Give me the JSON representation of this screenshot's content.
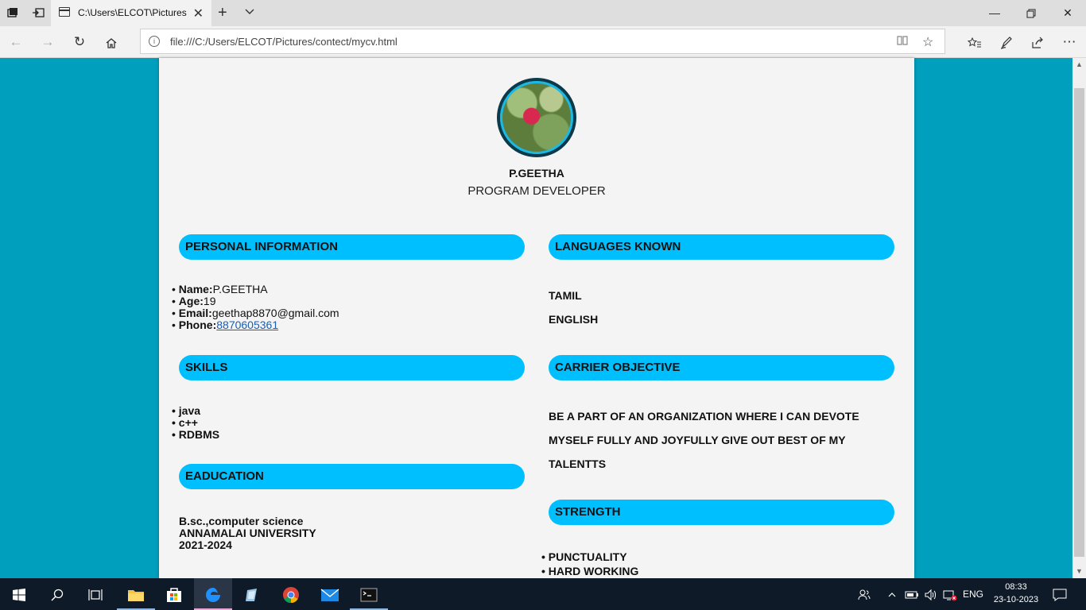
{
  "browser": {
    "tab_title": "C:\\Users\\ELCOT\\Pictures",
    "url": "file:///C:/Users/ELCOT/Pictures/contect/mycv.html"
  },
  "cv": {
    "name": "P.GEETHA",
    "role": "PROGRAM DEVELOPER",
    "personal": {
      "heading": "PERSONAL INFORMATION",
      "name_label": "Name:",
      "name_value": "P.GEETHA",
      "age_label": "Age:",
      "age_value": "19",
      "email_label": "Email:",
      "email_value": "geethap8870@gmail.com",
      "phone_label": "Phone:",
      "phone_value": "8870605361"
    },
    "skills": {
      "heading": "SKILLS",
      "items": [
        "java",
        "c++",
        "RDBMS"
      ]
    },
    "education": {
      "heading": "EADUCATION",
      "degree": "B.sc.,computer science",
      "university": "ANNAMALAI UNIVERSITY",
      "years": "2021-2024"
    },
    "languages": {
      "heading": "LANGUAGES KNOWN",
      "items": [
        "TAMIL",
        "ENGLISH"
      ]
    },
    "objective": {
      "heading": "CARRIER OBJECTIVE",
      "lines": [
        "BE A PART OF AN ORGANIZATION WHERE I CAN DEVOTE",
        "MYSELF FULLY AND JOYFULLY GIVE OUT BEST OF MY",
        "TALENTTS"
      ]
    },
    "strength": {
      "heading": "STRENGTH",
      "items": [
        "PUNCTUALITY",
        "HARD WORKING"
      ]
    }
  },
  "taskbar": {
    "language": "ENG",
    "time": "08:33",
    "date": "23-10-2023"
  }
}
